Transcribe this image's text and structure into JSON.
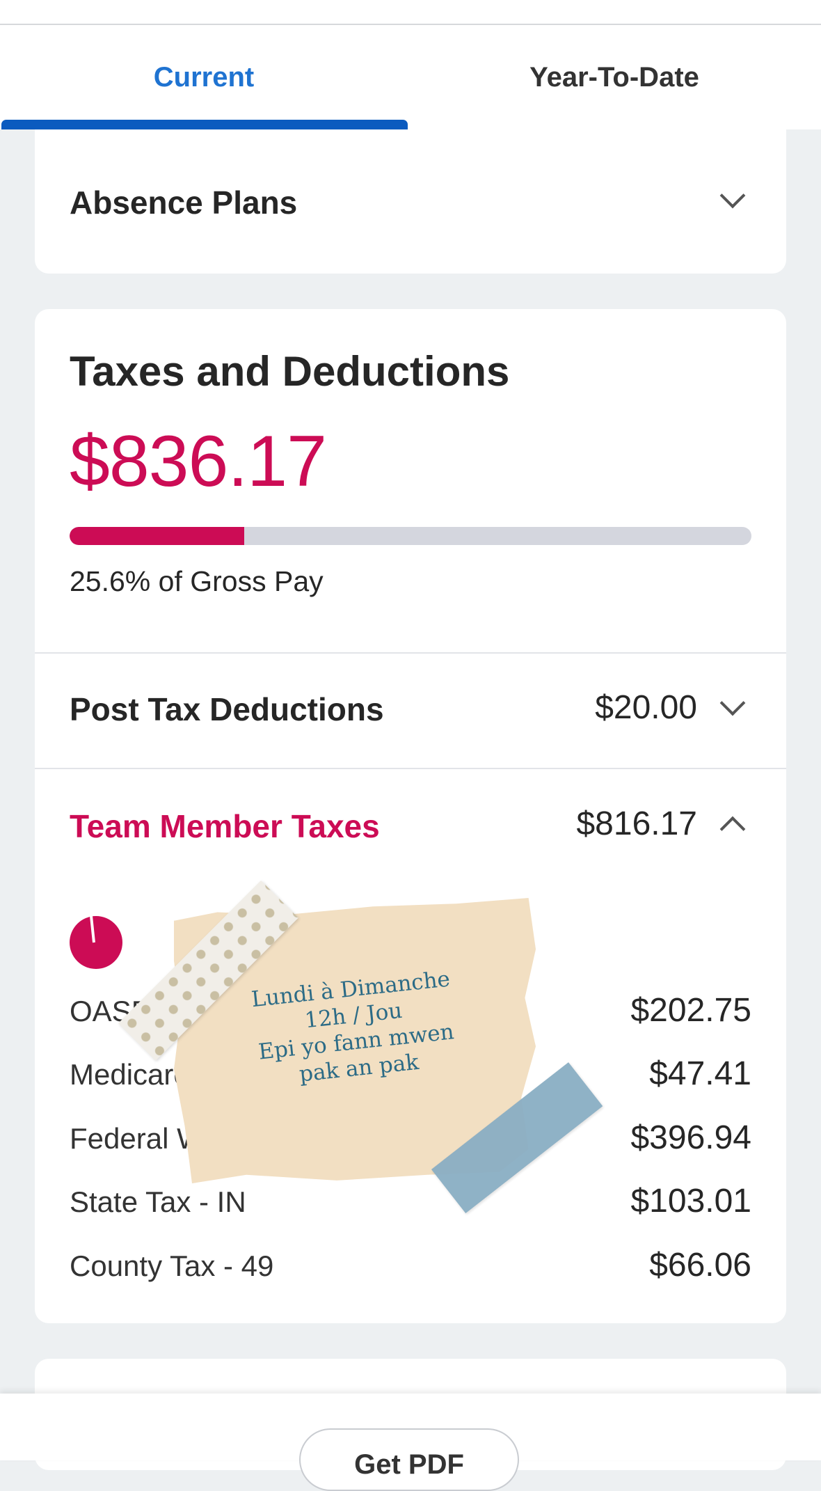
{
  "tabs": {
    "current": "Current",
    "ytd": "Year-To-Date"
  },
  "absence": {
    "title": "Absence Plans"
  },
  "taxes": {
    "title": "Taxes and Deductions",
    "total": "$836.17",
    "percent_of_gross": 25.6,
    "percent_label": "25.6% of Gross Pay",
    "post_tax": {
      "label": "Post Tax Deductions",
      "amount": "$20.00"
    },
    "team_member": {
      "label": "Team Member Taxes",
      "amount": "$816.17",
      "items": [
        {
          "label": "OASDI",
          "amount": "$202.75"
        },
        {
          "label": "Medicare",
          "amount": "$47.41"
        },
        {
          "label": "Federal Withholding",
          "amount": "$396.94"
        },
        {
          "label": "State Tax - IN",
          "amount": "$103.01"
        },
        {
          "label": "County Tax - 49",
          "amount": "$66.06"
        }
      ]
    }
  },
  "note": {
    "line1": "Lundi à Dimanche",
    "line2": "12h / Jou",
    "line3": "Epi yo fann mwen",
    "line4": "pak an pak"
  },
  "footer": {
    "pdf_button": "Get PDF"
  },
  "colors": {
    "accent_blue": "#1f73d1",
    "accent_red": "#cc0c55"
  }
}
